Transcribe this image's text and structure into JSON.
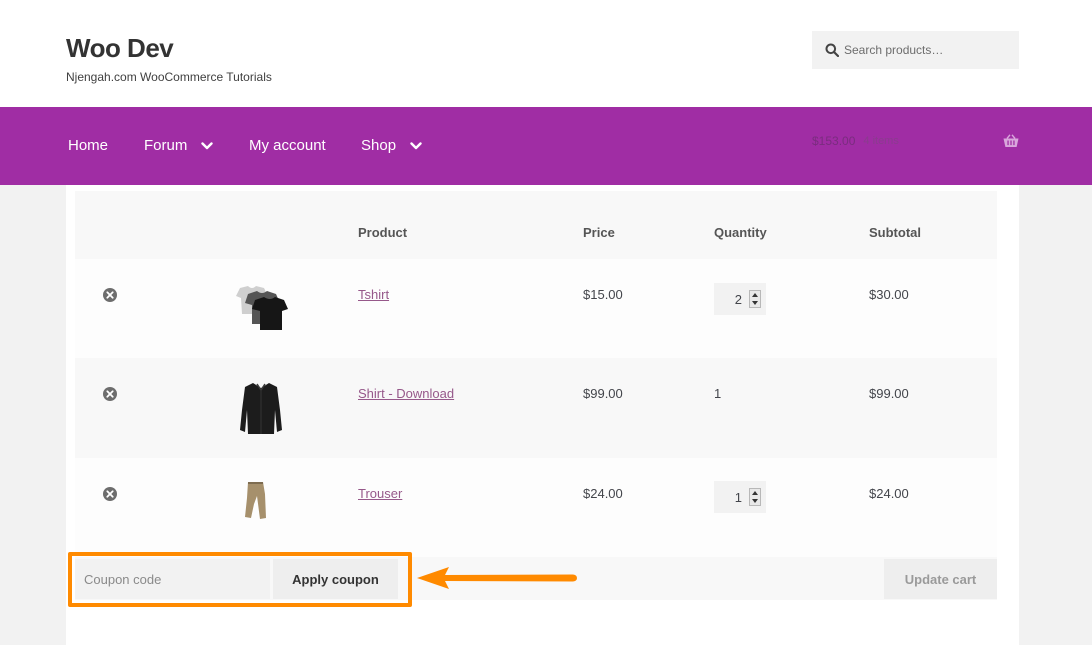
{
  "site": {
    "title": "Woo Dev",
    "tagline": "Njengah.com WooCommerce Tutorials"
  },
  "search": {
    "placeholder": "Search products…",
    "icon": "search-icon"
  },
  "nav": {
    "items": [
      {
        "label": "Home",
        "has_dropdown": false
      },
      {
        "label": "Forum",
        "has_dropdown": true
      },
      {
        "label": "My account",
        "has_dropdown": false
      },
      {
        "label": "Shop",
        "has_dropdown": true
      }
    ],
    "cart_total": "$153.00",
    "cart_count": "4 items",
    "cart_icon": "basket-icon"
  },
  "cart": {
    "headers": [
      "Product",
      "Price",
      "Quantity",
      "Subtotal"
    ],
    "rows": [
      {
        "product": "Tshirt",
        "price": "$15.00",
        "quantity": "2",
        "quantity_editable": true,
        "subtotal": "$30.00",
        "image": "tshirt-image"
      },
      {
        "product": "Shirt - Download",
        "price": "$99.00",
        "quantity": "1",
        "quantity_editable": false,
        "subtotal": "$99.00",
        "image": "shirt-image"
      },
      {
        "product": "Trouser",
        "price": "$24.00",
        "quantity": "1",
        "quantity_editable": true,
        "subtotal": "$24.00",
        "image": "trouser-image"
      }
    ]
  },
  "actions": {
    "coupon_placeholder": "Coupon code",
    "apply_label": "Apply coupon",
    "update_label": "Update cart"
  },
  "colors": {
    "brand": "#a02da4",
    "link": "#96588a",
    "annotation": "#ff8a00"
  }
}
